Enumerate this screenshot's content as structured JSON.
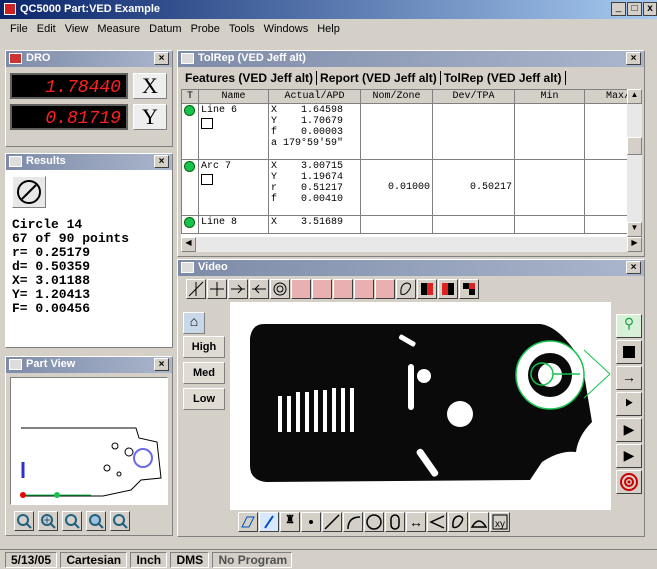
{
  "app": {
    "title": "QC5000 Part:VED Example",
    "win_min": "_",
    "win_max": "□",
    "win_close": "x"
  },
  "menu": [
    "File",
    "Edit",
    "View",
    "Measure",
    "Datum",
    "Probe",
    "Tools",
    "Windows",
    "Help"
  ],
  "dro": {
    "title": "DRO",
    "x_value": "1.78440",
    "x_label": "X",
    "y_value": "0.81719",
    "y_label": "Y"
  },
  "results": {
    "title": "Results",
    "lines": [
      "Circle 14",
      "67 of 90 points",
      "r= 0.25179",
      "d= 0.50359",
      "X= 3.01188",
      "Y= 1.20413",
      "F= 0.00456"
    ]
  },
  "partview": {
    "title": "Part View"
  },
  "tolrep": {
    "title": "TolRep (VED Jeff alt)",
    "tabs": [
      "Features (VED Jeff alt)",
      "Report (VED Jeff alt)",
      "TolRep (VED Jeff alt)"
    ],
    "headers": [
      "T",
      "Name",
      "Actual/APD",
      "Nom/Zone",
      "Dev/TPA",
      "Min",
      "Max/"
    ],
    "rows": [
      {
        "name": "Line 6",
        "actual": "X    1.64598\nY    1.70679\nf    0.00003\na 179°59'59\"",
        "nom": "",
        "dev": ""
      },
      {
        "name": "Arc 7",
        "actual": "X    3.00715\nY    1.19674\nr    0.51217\nf    0.00410",
        "nom": "0.01000",
        "dev": "0.50217"
      },
      {
        "name": "Line 8",
        "actual": "X    3.51689",
        "nom": "",
        "dev": ""
      }
    ]
  },
  "video": {
    "title": "Video",
    "buttons": [
      "High",
      "Med",
      "Low"
    ]
  },
  "status": [
    "5/13/05",
    "Cartesian",
    "Inch",
    "DMS",
    "No Program"
  ],
  "colors": {
    "accent_green": "#17c34f",
    "title_bar": "#7e8ba8",
    "part_blue": "#6a6af0"
  }
}
